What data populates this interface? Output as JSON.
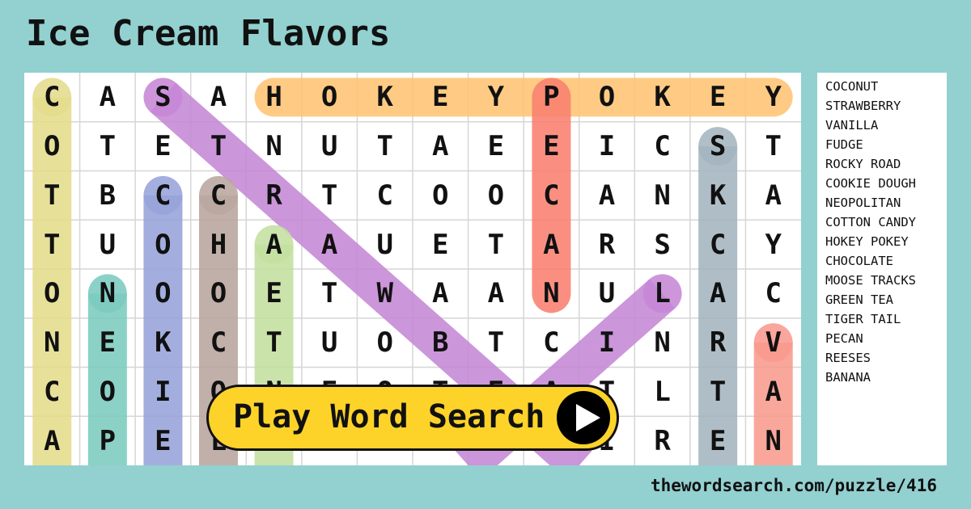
{
  "title": "Ice Cream Flavors",
  "grid": [
    "CASAHOKEYPOKEY",
    "OTETNUTAEEICST",
    "TBCCRTCOOCANKA",
    "TUOHAAUETARSCY",
    "ONOOETWAANULAC",
    "NEKCTUOBTCINRV",
    "COIONEOTEATLTA",
    "APELEAKOOTIREN"
  ],
  "highlights": [
    {
      "word": "COTTON CANDY",
      "color": "#e4dc8c",
      "from": [
        0,
        0
      ],
      "to": [
        8,
        0
      ]
    },
    {
      "word": "HOKEY POKEY",
      "color": "#ffc474",
      "from": [
        0,
        4
      ],
      "to": [
        0,
        13
      ]
    },
    {
      "word": "STRAWBERRY",
      "color": "#c688d6",
      "from": [
        0,
        2
      ],
      "to": [
        9,
        11
      ]
    },
    {
      "word": "TIGER TAIL",
      "color": "#c688d6",
      "from": [
        4,
        11
      ],
      "to": [
        9,
        6
      ]
    },
    {
      "word": "PECAN",
      "color": "#fa8070",
      "from": [
        0,
        9
      ],
      "to": [
        4,
        9
      ]
    },
    {
      "word": "MOOSE TRACKS",
      "color": "#a4b5bf",
      "from": [
        1,
        12
      ],
      "to": [
        8,
        12
      ]
    },
    {
      "word": "VANILLA",
      "color": "#f99a8e",
      "from": [
        5,
        13
      ],
      "to": [
        8,
        13
      ]
    },
    {
      "word": "NEOPOLITAN",
      "color": "#7ccbbf",
      "from": [
        4,
        1
      ],
      "to": [
        8,
        1
      ]
    },
    {
      "word": "COOKIE DOUGH",
      "color": "#97a3db",
      "from": [
        2,
        2
      ],
      "to": [
        8,
        2
      ]
    },
    {
      "word": "CHOCOLATE",
      "color": "#b9a69e",
      "from": [
        2,
        3
      ],
      "to": [
        8,
        3
      ]
    },
    {
      "word": "GREEN TEA",
      "color": "#c3e0a0",
      "from": [
        3,
        4
      ],
      "to": [
        8,
        4
      ]
    }
  ],
  "word_list": [
    "COCONUT",
    "STRAWBERRY",
    "VANILLA",
    "FUDGE",
    "ROCKY ROAD",
    "COOKIE DOUGH",
    "NEOPOLITAN",
    "COTTON CANDY",
    "HOKEY POKEY",
    "CHOCOLATE",
    "MOOSE TRACKS",
    "GREEN TEA",
    "TIGER TAIL",
    "PECAN",
    "REESES",
    "BANANA"
  ],
  "play_button": {
    "label": "Play Word Search",
    "icon": "play-icon",
    "color": "#fdd32a"
  },
  "footer": "thewordsearch.com/puzzle/416"
}
